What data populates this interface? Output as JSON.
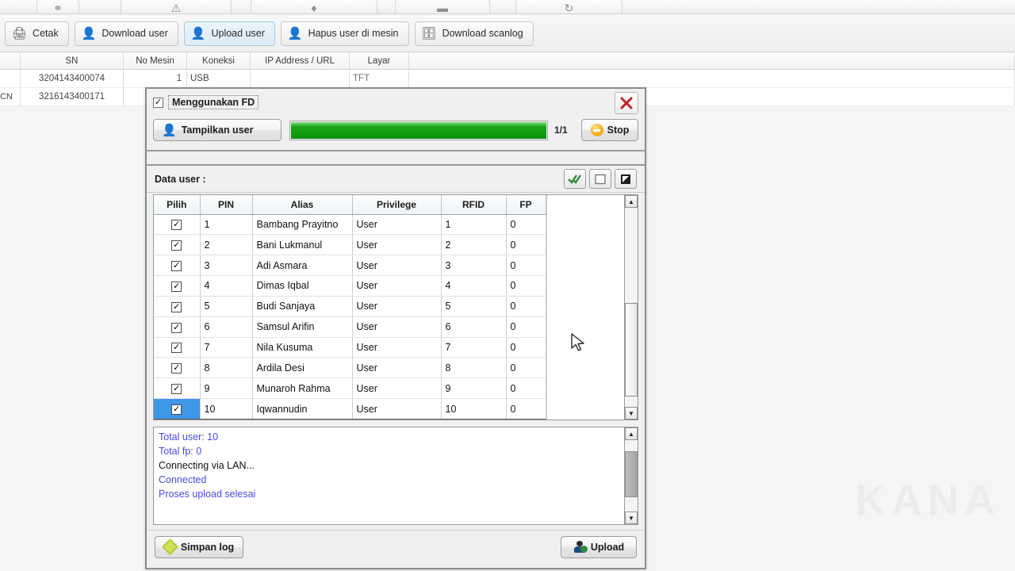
{
  "background": {
    "toolbar_top_icons": [
      "link-icon",
      "warning-user-icon",
      "badge-icon",
      "card-icon",
      "refresh-icon"
    ],
    "toolbar": [
      {
        "label": "Cetak",
        "icon": "printer-icon",
        "active": false
      },
      {
        "label": "Download user",
        "icon": "user-download-icon",
        "active": false
      },
      {
        "label": "Upload user",
        "icon": "user-upload-icon",
        "active": true
      },
      {
        "label": "Hapus user di mesin",
        "icon": "user-delete-icon",
        "active": false
      },
      {
        "label": "Download scanlog",
        "icon": "scanlog-icon",
        "active": false
      }
    ],
    "grid": {
      "headers": [
        "",
        "SN",
        "No Mesin",
        "Koneksi",
        "IP Address / URL",
        "Layar",
        ""
      ],
      "rows": [
        {
          "prefix": "",
          "sn": "3204143400074",
          "no_mesin": "1",
          "koneksi": "USB",
          "ip": "",
          "layar": "TFT"
        },
        {
          "prefix": "CN",
          "sn": "3216143400171",
          "no_mesin": "",
          "koneksi": "",
          "ip": "",
          "layar": ""
        }
      ]
    },
    "watermark": "KANA"
  },
  "dialog": {
    "fd_checkbox": {
      "label": "Menggunakan FD",
      "checked": true,
      "mark": "✓"
    },
    "close_icon": "close-x-icon",
    "show_users_button": {
      "label": "Tampilkan user",
      "icon": "show-user-icon"
    },
    "progress": {
      "percent": 100,
      "count_label": "1/1"
    },
    "stop_button": {
      "label": "Stop",
      "icon": "stop-icon"
    },
    "data_user_label": "Data user :",
    "mini_buttons": [
      {
        "name": "select-all-button",
        "icon": "double-check-icon"
      },
      {
        "name": "deselect-all-button",
        "icon": "empty-box-icon"
      },
      {
        "name": "invert-selection-button",
        "icon": "flag-icon"
      }
    ],
    "table": {
      "headers": [
        "Pilih",
        "PIN",
        "Alias",
        "Privilege",
        "RFID",
        "FP"
      ],
      "rows": [
        {
          "checked": true,
          "mark": "✓",
          "pin": "1",
          "alias": "Bambang Prayitno",
          "privilege": "User",
          "rfid": "1",
          "fp": "0",
          "selected": false
        },
        {
          "checked": true,
          "mark": "✓",
          "pin": "2",
          "alias": "Bani Lukmanul",
          "privilege": "User",
          "rfid": "2",
          "fp": "0",
          "selected": false
        },
        {
          "checked": true,
          "mark": "✓",
          "pin": "3",
          "alias": "Adi Asmara",
          "privilege": "User",
          "rfid": "3",
          "fp": "0",
          "selected": false
        },
        {
          "checked": true,
          "mark": "✓",
          "pin": "4",
          "alias": "Dimas Iqbal",
          "privilege": "User",
          "rfid": "4",
          "fp": "0",
          "selected": false
        },
        {
          "checked": true,
          "mark": "✓",
          "pin": "5",
          "alias": "Budi Sanjaya",
          "privilege": "User",
          "rfid": "5",
          "fp": "0",
          "selected": false
        },
        {
          "checked": true,
          "mark": "✓",
          "pin": "6",
          "alias": "Samsul Arifin",
          "privilege": "User",
          "rfid": "6",
          "fp": "0",
          "selected": false
        },
        {
          "checked": true,
          "mark": "✓",
          "pin": "7",
          "alias": "Nila Kusuma",
          "privilege": "User",
          "rfid": "7",
          "fp": "0",
          "selected": false
        },
        {
          "checked": true,
          "mark": "✓",
          "pin": "8",
          "alias": "Ardila Desi",
          "privilege": "User",
          "rfid": "8",
          "fp": "0",
          "selected": false
        },
        {
          "checked": true,
          "mark": "✓",
          "pin": "9",
          "alias": "Munaroh Rahma",
          "privilege": "User",
          "rfid": "9",
          "fp": "0",
          "selected": false
        },
        {
          "checked": true,
          "mark": "✓",
          "pin": "10",
          "alias": "Iqwannudin",
          "privilege": "User",
          "rfid": "10",
          "fp": "0",
          "selected": true
        }
      ]
    },
    "log": [
      {
        "text": "Total user: 10",
        "color": "blue"
      },
      {
        "text": "Total fp: 0",
        "color": "blue"
      },
      {
        "text": "Connecting via LAN...",
        "color": "black"
      },
      {
        "text": "Connected",
        "color": "blue"
      },
      {
        "text": "Proses upload selesai",
        "color": "blue"
      }
    ],
    "save_log_button": {
      "label": "Simpan log",
      "icon": "diamond-save-icon"
    },
    "upload_button": {
      "label": "Upload",
      "icon": "user-upload-icon"
    }
  },
  "colors": {
    "progress_green": "#17a317",
    "log_blue": "#4a4af0",
    "selection_blue": "#3d97e8",
    "accent_toolbar_active": "#dcebf7"
  }
}
